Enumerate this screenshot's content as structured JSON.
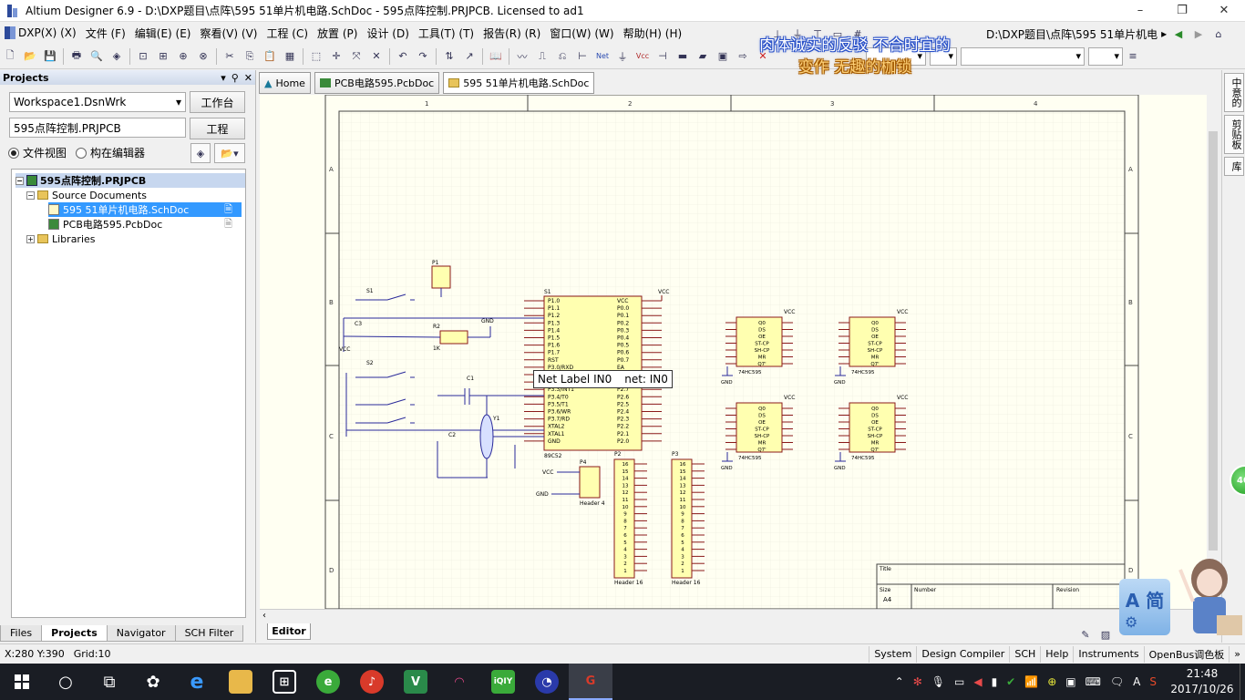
{
  "window": {
    "title": "Altium Designer 6.9 - D:\\DXP题目\\点阵\\595 51单片机电路.SchDoc - 595点阵控制.PRJPCB. Licensed to ad1",
    "minimize": "–",
    "restore": "❐",
    "close": "✕"
  },
  "menu": {
    "items": [
      "DXP(X) (X)",
      "文件 (F)",
      "编辑(E) (E)",
      "察看(V) (V)",
      "工程 (C)",
      "放置 (P)",
      "设计 (D)",
      "工具(T) (T)",
      "报告(R) (R)",
      "窗口(W) (W)",
      "帮助(H) (H)"
    ],
    "path": "D:\\DXP题目\\点阵\\595 51单片机电"
  },
  "overlay": {
    "line1": "肉体诚实的反驳 不合时宜的",
    "line2": "变作 无趣的枷锁"
  },
  "panel": {
    "title": "Projects",
    "workspace": "Workspace1.DsnWrk",
    "workspace_button": "工作台",
    "project": "595点阵控制.PRJPCB",
    "project_button": "工程",
    "radio_file_view": "文件视图",
    "radio_struct_editor": "构在编辑器",
    "tree": {
      "root": "595点阵控制.PRJPCB",
      "source_docs": "Source Documents",
      "doc1": "595 51单片机电路.SchDoc",
      "doc2": "PCB电路595.PcbDoc",
      "libraries": "Libraries"
    },
    "tabs": [
      "Files",
      "Projects",
      "Navigator",
      "SCH Filter"
    ]
  },
  "doc_tabs": {
    "home": "Home",
    "pcb": "PCB电路595.PcbDoc",
    "sch": "595 51单片机电路.SchDoc"
  },
  "schematic": {
    "col_labels": [
      "1",
      "2",
      "3",
      "4"
    ],
    "row_labels": [
      "A",
      "B",
      "C",
      "D"
    ],
    "netlabel_tip_label": "Net Label IN0",
    "netlabel_tip_net": "net: IN0",
    "mcu_name": "89C52",
    "mcu_ref": "S1",
    "mcu_left_pins": [
      "P1.0",
      "P1.1",
      "P1.2",
      "P1.3",
      "P1.4",
      "P1.5",
      "P1.6",
      "P1.7",
      "RST",
      "P3.0/RXD",
      "P3.1/TXD",
      "P3.2/INT0",
      "P3.3/INT1",
      "P3.4/T0",
      "P3.5/T1",
      "P3.6/WR",
      "P3.7/RD",
      "XTAL2",
      "XTAL1",
      "GND"
    ],
    "mcu_right_pins": [
      "VCC",
      "P0.0",
      "P0.1",
      "P0.2",
      "P0.3",
      "P0.4",
      "P0.5",
      "P0.6",
      "P0.7",
      "EA",
      "ALE",
      "PSEN",
      "P2.7",
      "P2.6",
      "P2.5",
      "P2.4",
      "P2.3",
      "P2.2",
      "P2.1",
      "P2.0"
    ],
    "chip_595": "74HC595",
    "chip_pins": [
      "Q0",
      "DS",
      "OE",
      "ST-CP",
      "SH-CP",
      "MR",
      "Q7'"
    ],
    "header16": "Header 16",
    "header4": "Header 4",
    "vcc": "VCC",
    "gnd": "GND",
    "title_block": {
      "title": "Title",
      "size": "Size",
      "size_val": "A4",
      "number": "Number",
      "revision": "Revision"
    }
  },
  "editor_tab": "Editor",
  "status": {
    "coords": "X:280 Y:390",
    "grid": "Grid:10",
    "items": [
      "System",
      "Design Compiler",
      "SCH",
      "Help",
      "Instruments",
      "OpenBus调色板"
    ]
  },
  "right_tabs": [
    "中意的",
    "剪贴板",
    "库"
  ],
  "badge": "40",
  "logo_text": "A 简",
  "taskbar": {
    "time": "21:48",
    "date": "2017/10/26",
    "ime": "A"
  }
}
